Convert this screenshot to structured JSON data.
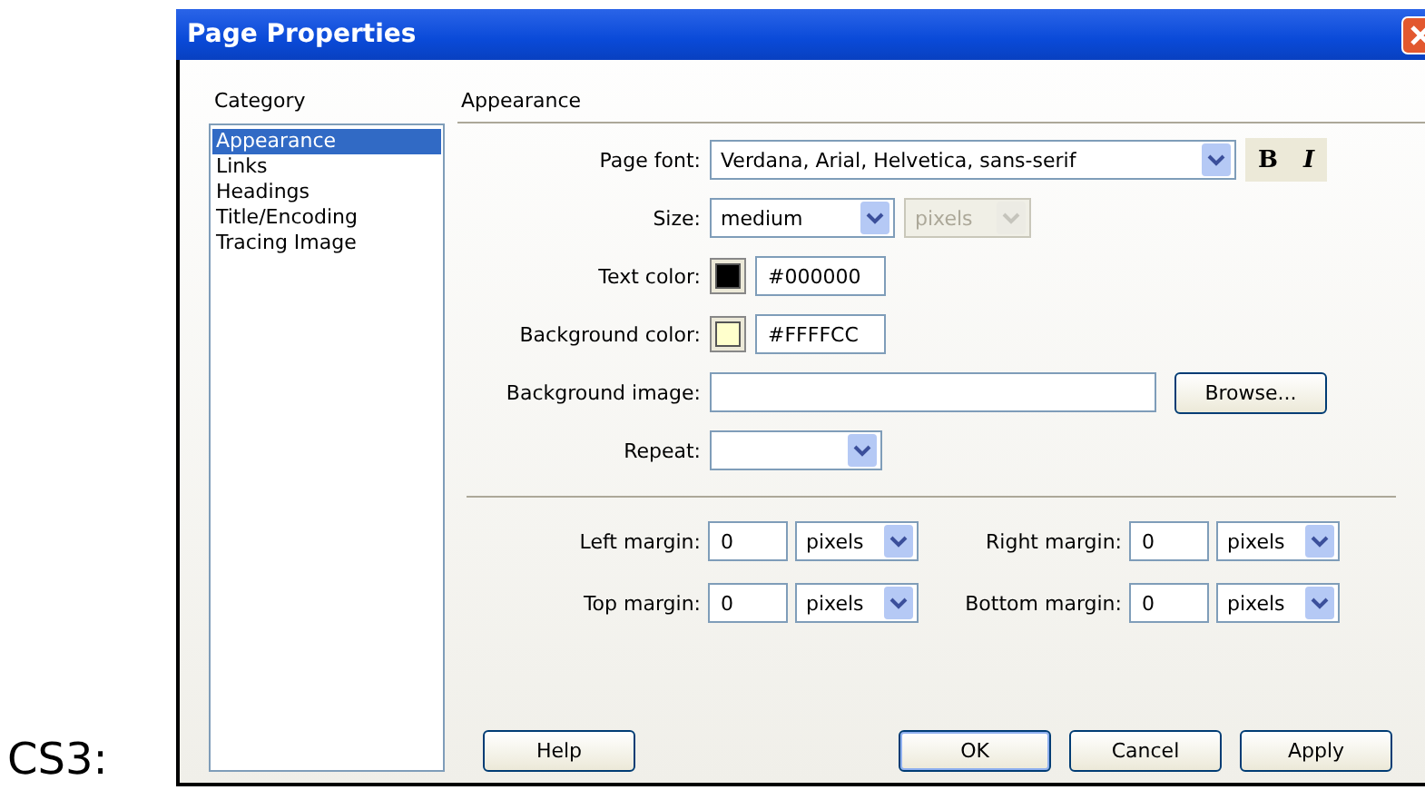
{
  "prefix_label": "CS3:",
  "dialog": {
    "title": "Page Properties"
  },
  "category": {
    "heading": "Category",
    "items": [
      {
        "label": "Appearance",
        "selected": true
      },
      {
        "label": "Links",
        "selected": false
      },
      {
        "label": "Headings",
        "selected": false
      },
      {
        "label": "Title/Encoding",
        "selected": false
      },
      {
        "label": "Tracing Image",
        "selected": false
      }
    ]
  },
  "panel": {
    "heading": "Appearance",
    "page_font": {
      "label": "Page font:",
      "value": "Verdana, Arial, Helvetica, sans-serif",
      "style_buttons": [
        "B",
        "I"
      ]
    },
    "size": {
      "label": "Size:",
      "value": "medium",
      "unit": "pixels",
      "unit_disabled": true
    },
    "text_color": {
      "label": "Text color:",
      "color": "#000000",
      "value": "#000000"
    },
    "background_color": {
      "label": "Background color:",
      "color": "#ffffcc",
      "value": "#FFFFCC"
    },
    "background_image": {
      "label": "Background image:",
      "button": "Browse..."
    },
    "repeat": {
      "label": "Repeat:"
    },
    "margins": [
      {
        "label": "Left margin:",
        "value": "0",
        "unit": "pixels"
      },
      {
        "label": "Right margin:",
        "value": "0",
        "unit": "pixels"
      },
      {
        "label": "Top margin:",
        "value": "0",
        "unit": "pixels"
      },
      {
        "label": "Bottom margin:",
        "value": "0",
        "unit": "pixels"
      }
    ]
  },
  "buttons": {
    "help": "Help",
    "actions": [
      "OK",
      "Cancel",
      "Apply"
    ]
  }
}
